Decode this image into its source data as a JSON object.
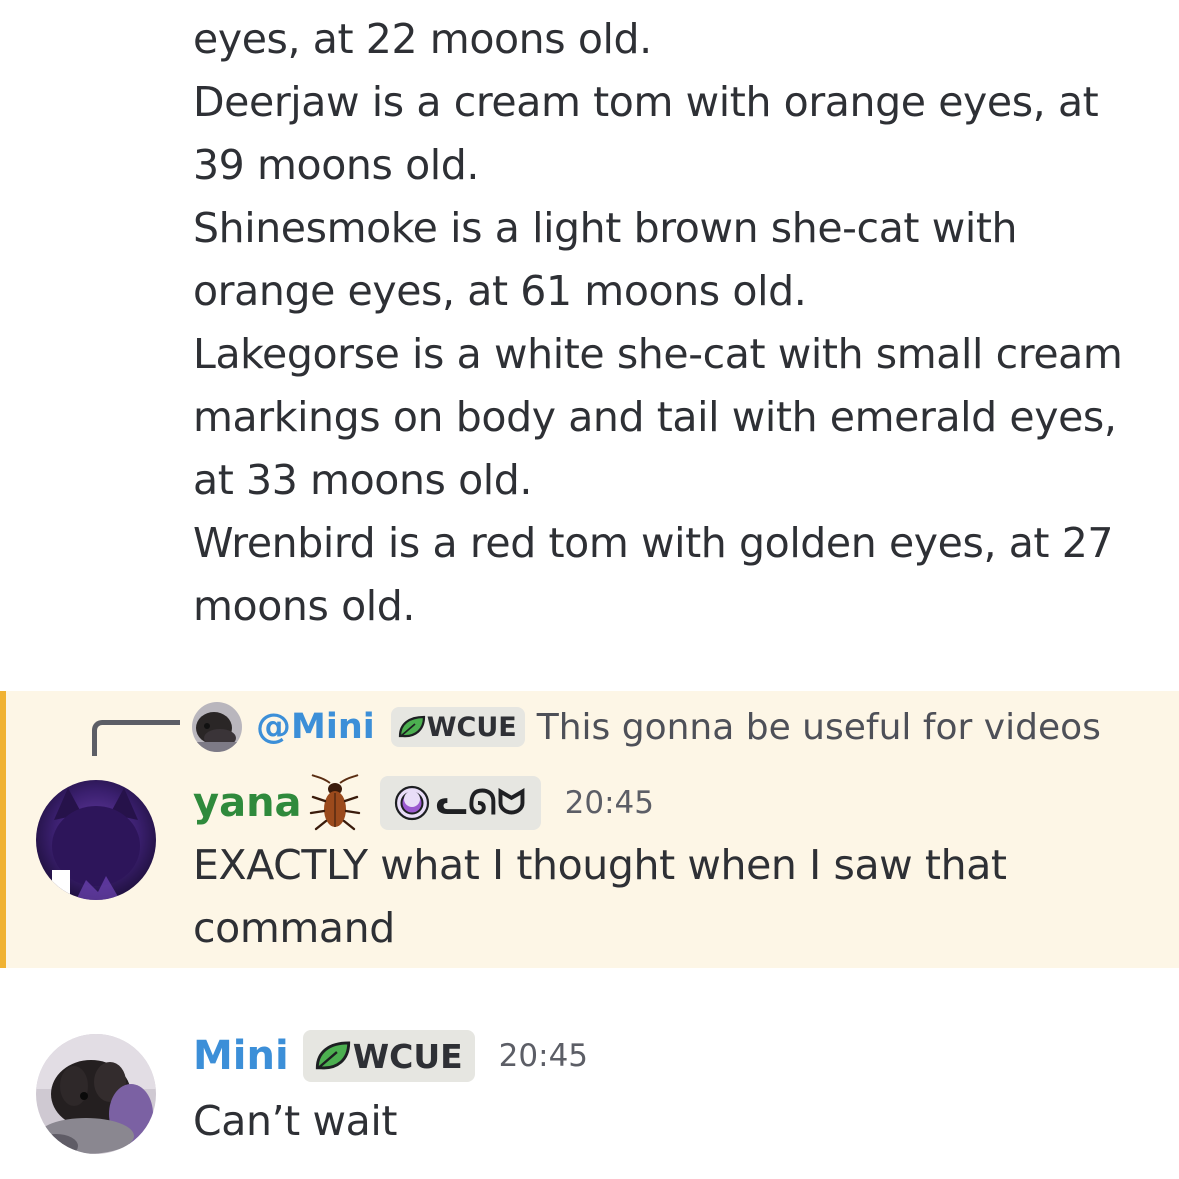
{
  "previous_message": {
    "lines": [
      "eyes, at 22 moons old.",
      "Deerjaw is a cream tom with orange eyes, at",
      "39 moons old.",
      "Shinesmoke is a light brown she-cat with",
      "orange eyes, at 61 moons old.",
      "Lakegorse is a white she-cat with small cream",
      "markings on body and tail with emerald eyes,",
      "at 33 moons old.",
      "Wrenbird is a red tom with golden eyes, at 27",
      "moons old."
    ]
  },
  "reply": {
    "author": "@Mini",
    "tag": "WCUE",
    "text": "This gonna be useful for videos"
  },
  "message_yana": {
    "author": "yana",
    "role_tag": "ᓚᘏᗢ",
    "timestamp": "20:45",
    "lines": [
      "EXACTLY what I thought when I saw that",
      "command"
    ]
  },
  "message_mini": {
    "author": "Mini",
    "tag": "WCUE",
    "timestamp": "20:45",
    "lines": [
      "Can’t wait"
    ]
  },
  "colors": {
    "mention_bg": "#fdf6e6",
    "mention_bar": "#f0b232",
    "mini_name": "#3c8fd8",
    "yana_name": "#2f8a3c",
    "tag_bg": "#e6e6e1",
    "leaf": "#4caf50",
    "moon_role": "#9b59d0"
  },
  "icons": [
    "leaf-icon",
    "cockroach-icon",
    "moon-icon"
  ]
}
